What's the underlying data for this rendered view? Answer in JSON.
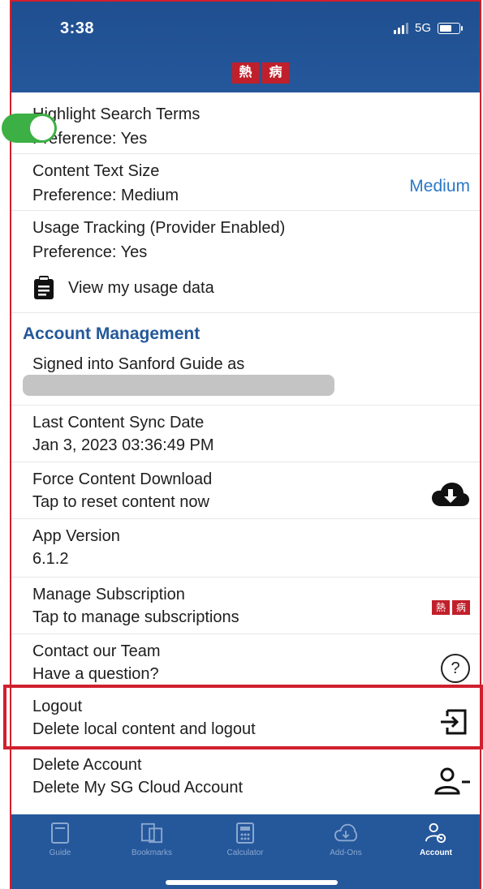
{
  "status_bar": {
    "time": "3:38",
    "network": "5G"
  },
  "header": {
    "logo_chars": [
      "熱",
      "病"
    ]
  },
  "preferences": {
    "highlight": {
      "title": "Highlight Search Terms",
      "subtitle": "Preference: Yes",
      "toggle_on": true
    },
    "text_size": {
      "title": "Content Text Size",
      "subtitle": "Preference: Medium",
      "value": "Medium"
    },
    "usage": {
      "title": "Usage Tracking (Provider Enabled)",
      "subtitle": "Preference: Yes",
      "link": "View my usage data"
    }
  },
  "account": {
    "section_title": "Account Management",
    "signed_in": {
      "title": "Signed into Sanford Guide as"
    },
    "sync": {
      "title": "Last Content Sync Date",
      "subtitle": "Jan 3, 2023 03:36:49 PM"
    },
    "force": {
      "title": "Force Content Download",
      "subtitle": "Tap to reset content now"
    },
    "version": {
      "title": "App Version",
      "subtitle": "6.1.2"
    },
    "subscription": {
      "title": "Manage Subscription",
      "subtitle": "Tap to manage subscriptions"
    },
    "contact": {
      "title": "Contact our Team",
      "subtitle": "Have a question?"
    },
    "logout": {
      "title": "Logout",
      "subtitle": "Delete local content and logout"
    },
    "delete": {
      "title": "Delete Account",
      "subtitle": "Delete My SG Cloud Account"
    }
  },
  "tabs": [
    {
      "label": "Guide",
      "icon": "book-icon"
    },
    {
      "label": "Bookmarks",
      "icon": "bookmarks-icon"
    },
    {
      "label": "Calculator",
      "icon": "calculator-icon"
    },
    {
      "label": "Add-Ons",
      "icon": "cloud-download-icon"
    },
    {
      "label": "Account",
      "icon": "account-gear-icon",
      "active": true
    }
  ],
  "colors": {
    "brand_blue": "#25579b",
    "accent_blue": "#2b78c5",
    "toggle_green": "#3cb044",
    "highlight_red": "#d0202e"
  }
}
